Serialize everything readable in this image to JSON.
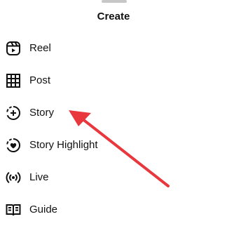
{
  "sheet": {
    "title": "Create"
  },
  "menu": {
    "items": [
      {
        "label": "Reel",
        "icon": "reel-icon"
      },
      {
        "label": "Post",
        "icon": "grid-icon"
      },
      {
        "label": "Story",
        "icon": "story-add-icon"
      },
      {
        "label": "Story Highlight",
        "icon": "highlight-heart-icon"
      },
      {
        "label": "Live",
        "icon": "live-broadcast-icon"
      },
      {
        "label": "Guide",
        "icon": "guide-book-icon"
      }
    ]
  },
  "annotation": {
    "arrow_color": "#e8383d"
  }
}
